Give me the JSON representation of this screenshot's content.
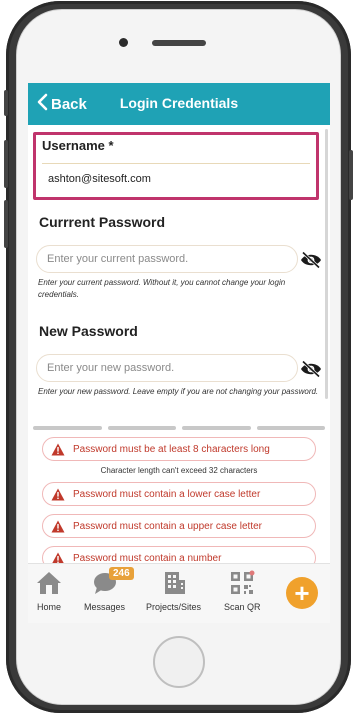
{
  "header": {
    "back_label": "Back",
    "title": "Login Credentials"
  },
  "username": {
    "label": "Username *",
    "value": "ashton@sitesoft.com"
  },
  "current_password": {
    "label": "Currrent Password",
    "placeholder": "Enter your current password.",
    "hint": "Enter your current password. Without it, you cannot change your login credentials."
  },
  "new_password": {
    "label": "New Password",
    "placeholder": "Enter your new password.",
    "hint": "Enter your new password. Leave empty if you are not changing your password."
  },
  "rules": [
    {
      "text": "Password must be at least 8 characters long"
    },
    {
      "text": "Password must contain a lower case letter"
    },
    {
      "text": "Password must contain a upper case letter"
    },
    {
      "text": "Password must contain a number"
    }
  ],
  "rule_note": "Character length can't exceed 32 characters",
  "nav": {
    "home": "Home",
    "messages": "Messages",
    "messages_badge": "246",
    "projects": "Projects/Sites",
    "scan": "Scan QR",
    "fab": "+"
  },
  "colors": {
    "header": "#1fa2b5",
    "highlight_border": "#c0346c",
    "warning": "#c0392b",
    "accent": "#f0a12c"
  }
}
